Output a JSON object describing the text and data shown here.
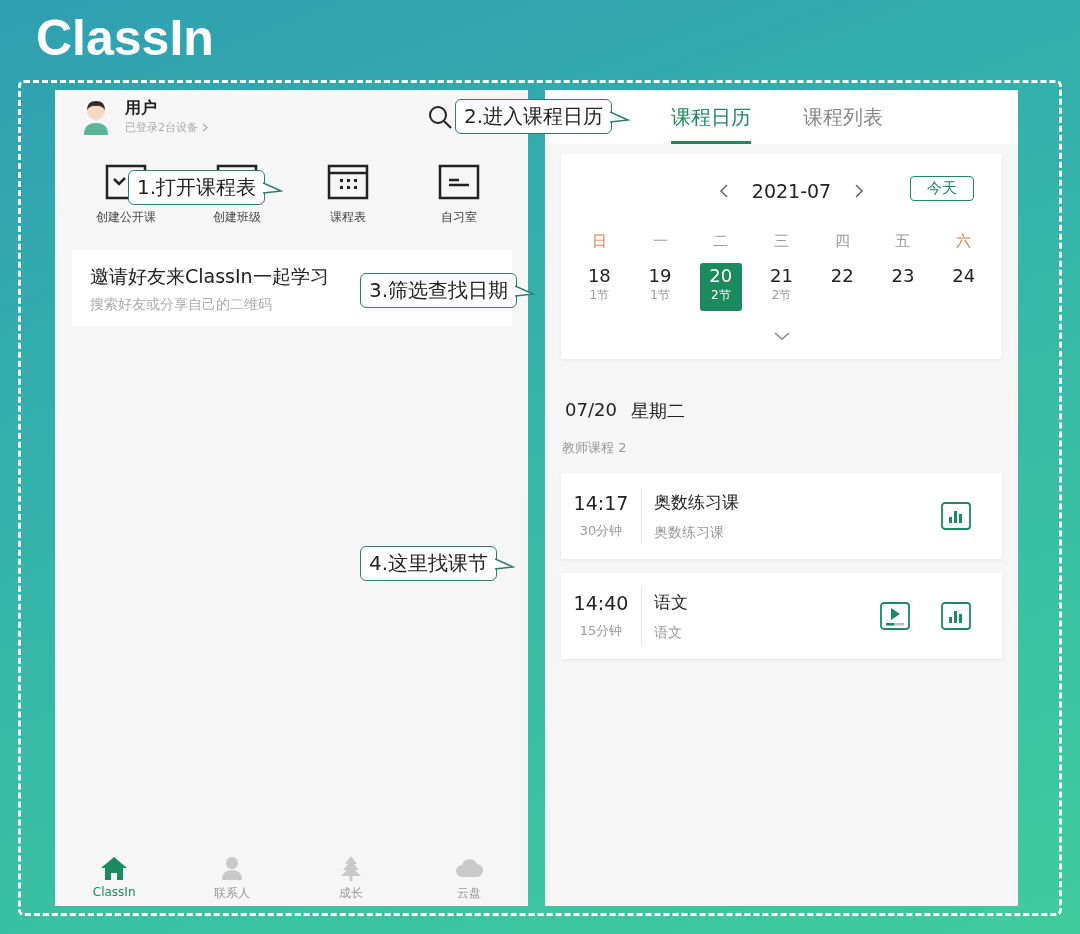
{
  "logo": "ClassIn",
  "left": {
    "user": {
      "name": "用户",
      "devices": "已登录2台设备"
    },
    "actions": [
      {
        "label": "创建公开课"
      },
      {
        "label": "创建班级"
      },
      {
        "label": "课程表"
      },
      {
        "label": "自习室"
      }
    ],
    "invite": {
      "title": "邀请好友来ClassIn一起学习",
      "subtitle": "搜索好友或分享自己的二维码"
    },
    "nav": [
      {
        "label": "ClassIn",
        "selected": true
      },
      {
        "label": "联系人",
        "selected": false
      },
      {
        "label": "成长",
        "selected": false
      },
      {
        "label": "云盘",
        "selected": false
      }
    ]
  },
  "right": {
    "tabs": [
      {
        "label": "课程日历",
        "selected": true
      },
      {
        "label": "课程列表",
        "selected": false
      }
    ],
    "calendar": {
      "month": "2021-07",
      "today_button": "今天",
      "weekdays": [
        {
          "label": "日",
          "weekend": true
        },
        {
          "label": "一",
          "weekend": false
        },
        {
          "label": "二",
          "weekend": false
        },
        {
          "label": "三",
          "weekend": false
        },
        {
          "label": "四",
          "weekend": false
        },
        {
          "label": "五",
          "weekend": false
        },
        {
          "label": "六",
          "weekend": true
        }
      ],
      "days": [
        {
          "day": "18",
          "count": "1节",
          "selected": false
        },
        {
          "day": "19",
          "count": "1节",
          "selected": false
        },
        {
          "day": "20",
          "count": "2节",
          "selected": true
        },
        {
          "day": "21",
          "count": "2节",
          "selected": false
        },
        {
          "day": "22",
          "selected": false
        },
        {
          "day": "23",
          "selected": false
        },
        {
          "day": "24",
          "selected": false
        }
      ]
    },
    "date": "07/20",
    "weekday": "星期二",
    "section": "教师课程 2",
    "lessons": [
      {
        "time": "14:17",
        "duration": "30分钟",
        "title": "奥数练习课",
        "subtitle": "奥数练习课",
        "replay": false
      },
      {
        "time": "14:40",
        "duration": "15分钟",
        "title": "语文",
        "subtitle": "语文",
        "replay": true
      }
    ]
  },
  "callouts": [
    {
      "text": "1.打开课程表"
    },
    {
      "text": "2.进入课程日历"
    },
    {
      "text": "3.筛选查找日期"
    },
    {
      "text": "4.这里找课节"
    }
  ]
}
